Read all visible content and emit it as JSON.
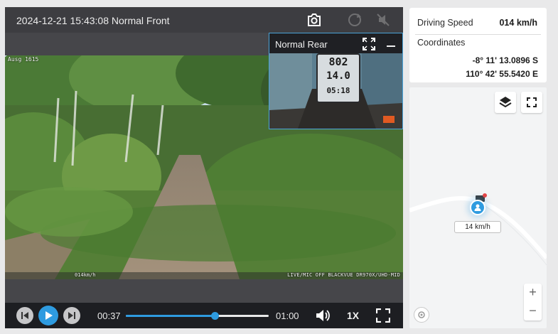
{
  "player": {
    "title": "2024-12-21 15:43:08 Normal Front",
    "icons": {
      "snapshot": "camera-icon",
      "rotate": "rotate-icon",
      "mute": "no-sound-icon"
    },
    "video_overlay": {
      "top_left": "Ausg 1615",
      "speed": "014km/h",
      "brand": "LIVE/MIC OFF BLACKVUE DR970X/UHD-MID"
    },
    "rear": {
      "title": "Normal Rear",
      "gauge_line1": "802",
      "gauge_line2": "14.0",
      "gauge_line3": "05:18"
    },
    "controls": {
      "current_time": "00:37",
      "end_time": "01:00",
      "progress": 0.62,
      "rate": "1X"
    }
  },
  "info": {
    "speed_label": "Driving Speed",
    "speed_value": "014 km/h",
    "coords_label": "Coordinates",
    "latitude": "-8° 11' 13.0896 S",
    "longitude": "110° 42' 55.5420 E"
  },
  "map": {
    "marker_speed": "14 km/h",
    "zoom_in": "+",
    "zoom_out": "−"
  },
  "colors": {
    "accent": "#2e9be0",
    "bar": "#1d1e22",
    "frame": "#46464a"
  }
}
